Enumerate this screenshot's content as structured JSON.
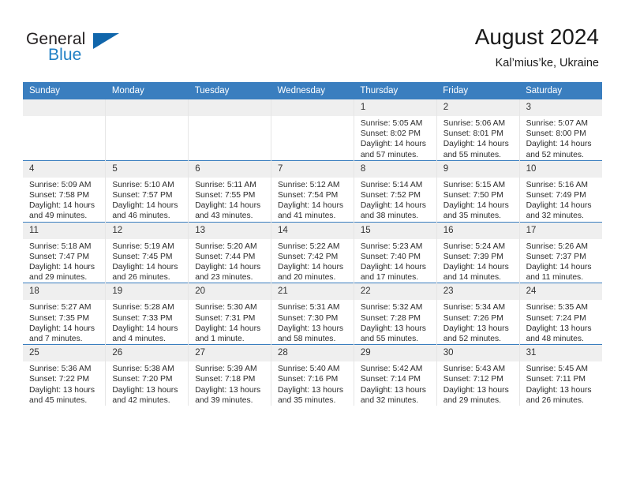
{
  "brand": {
    "name_part1": "General",
    "name_part2": "Blue",
    "triangle_color": "#1166ab",
    "blue_color": "#1f7fc4",
    "dark_color": "#231f20"
  },
  "header": {
    "month_title": "August 2024",
    "location": "Kal’mius’ke, Ukraine"
  },
  "theme": {
    "header_row_bg": "#3a7ebf",
    "daynum_bg": "#efefef",
    "row_rule": "#3a7ebf",
    "cell_border": "#e6e6e6"
  },
  "weekdays": [
    "Sunday",
    "Monday",
    "Tuesday",
    "Wednesday",
    "Thursday",
    "Friday",
    "Saturday"
  ],
  "labels": {
    "sunrise_prefix": "Sunrise:",
    "sunset_prefix": "Sunset:",
    "daylight_prefix": "Daylight:"
  },
  "weeks": [
    [
      {
        "day": "",
        "empty": true
      },
      {
        "day": "",
        "empty": true
      },
      {
        "day": "",
        "empty": true
      },
      {
        "day": "",
        "empty": true
      },
      {
        "day": "1",
        "sunrise": "Sunrise: 5:05 AM",
        "sunset": "Sunset: 8:02 PM",
        "daylight_1": "Daylight: 14 hours",
        "daylight_2": "and 57 minutes."
      },
      {
        "day": "2",
        "sunrise": "Sunrise: 5:06 AM",
        "sunset": "Sunset: 8:01 PM",
        "daylight_1": "Daylight: 14 hours",
        "daylight_2": "and 55 minutes."
      },
      {
        "day": "3",
        "sunrise": "Sunrise: 5:07 AM",
        "sunset": "Sunset: 8:00 PM",
        "daylight_1": "Daylight: 14 hours",
        "daylight_2": "and 52 minutes."
      }
    ],
    [
      {
        "day": "4",
        "sunrise": "Sunrise: 5:09 AM",
        "sunset": "Sunset: 7:58 PM",
        "daylight_1": "Daylight: 14 hours",
        "daylight_2": "and 49 minutes."
      },
      {
        "day": "5",
        "sunrise": "Sunrise: 5:10 AM",
        "sunset": "Sunset: 7:57 PM",
        "daylight_1": "Daylight: 14 hours",
        "daylight_2": "and 46 minutes."
      },
      {
        "day": "6",
        "sunrise": "Sunrise: 5:11 AM",
        "sunset": "Sunset: 7:55 PM",
        "daylight_1": "Daylight: 14 hours",
        "daylight_2": "and 43 minutes."
      },
      {
        "day": "7",
        "sunrise": "Sunrise: 5:12 AM",
        "sunset": "Sunset: 7:54 PM",
        "daylight_1": "Daylight: 14 hours",
        "daylight_2": "and 41 minutes."
      },
      {
        "day": "8",
        "sunrise": "Sunrise: 5:14 AM",
        "sunset": "Sunset: 7:52 PM",
        "daylight_1": "Daylight: 14 hours",
        "daylight_2": "and 38 minutes."
      },
      {
        "day": "9",
        "sunrise": "Sunrise: 5:15 AM",
        "sunset": "Sunset: 7:50 PM",
        "daylight_1": "Daylight: 14 hours",
        "daylight_2": "and 35 minutes."
      },
      {
        "day": "10",
        "sunrise": "Sunrise: 5:16 AM",
        "sunset": "Sunset: 7:49 PM",
        "daylight_1": "Daylight: 14 hours",
        "daylight_2": "and 32 minutes."
      }
    ],
    [
      {
        "day": "11",
        "sunrise": "Sunrise: 5:18 AM",
        "sunset": "Sunset: 7:47 PM",
        "daylight_1": "Daylight: 14 hours",
        "daylight_2": "and 29 minutes."
      },
      {
        "day": "12",
        "sunrise": "Sunrise: 5:19 AM",
        "sunset": "Sunset: 7:45 PM",
        "daylight_1": "Daylight: 14 hours",
        "daylight_2": "and 26 minutes."
      },
      {
        "day": "13",
        "sunrise": "Sunrise: 5:20 AM",
        "sunset": "Sunset: 7:44 PM",
        "daylight_1": "Daylight: 14 hours",
        "daylight_2": "and 23 minutes."
      },
      {
        "day": "14",
        "sunrise": "Sunrise: 5:22 AM",
        "sunset": "Sunset: 7:42 PM",
        "daylight_1": "Daylight: 14 hours",
        "daylight_2": "and 20 minutes."
      },
      {
        "day": "15",
        "sunrise": "Sunrise: 5:23 AM",
        "sunset": "Sunset: 7:40 PM",
        "daylight_1": "Daylight: 14 hours",
        "daylight_2": "and 17 minutes."
      },
      {
        "day": "16",
        "sunrise": "Sunrise: 5:24 AM",
        "sunset": "Sunset: 7:39 PM",
        "daylight_1": "Daylight: 14 hours",
        "daylight_2": "and 14 minutes."
      },
      {
        "day": "17",
        "sunrise": "Sunrise: 5:26 AM",
        "sunset": "Sunset: 7:37 PM",
        "daylight_1": "Daylight: 14 hours",
        "daylight_2": "and 11 minutes."
      }
    ],
    [
      {
        "day": "18",
        "sunrise": "Sunrise: 5:27 AM",
        "sunset": "Sunset: 7:35 PM",
        "daylight_1": "Daylight: 14 hours",
        "daylight_2": "and 7 minutes."
      },
      {
        "day": "19",
        "sunrise": "Sunrise: 5:28 AM",
        "sunset": "Sunset: 7:33 PM",
        "daylight_1": "Daylight: 14 hours",
        "daylight_2": "and 4 minutes."
      },
      {
        "day": "20",
        "sunrise": "Sunrise: 5:30 AM",
        "sunset": "Sunset: 7:31 PM",
        "daylight_1": "Daylight: 14 hours",
        "daylight_2": "and 1 minute."
      },
      {
        "day": "21",
        "sunrise": "Sunrise: 5:31 AM",
        "sunset": "Sunset: 7:30 PM",
        "daylight_1": "Daylight: 13 hours",
        "daylight_2": "and 58 minutes."
      },
      {
        "day": "22",
        "sunrise": "Sunrise: 5:32 AM",
        "sunset": "Sunset: 7:28 PM",
        "daylight_1": "Daylight: 13 hours",
        "daylight_2": "and 55 minutes."
      },
      {
        "day": "23",
        "sunrise": "Sunrise: 5:34 AM",
        "sunset": "Sunset: 7:26 PM",
        "daylight_1": "Daylight: 13 hours",
        "daylight_2": "and 52 minutes."
      },
      {
        "day": "24",
        "sunrise": "Sunrise: 5:35 AM",
        "sunset": "Sunset: 7:24 PM",
        "daylight_1": "Daylight: 13 hours",
        "daylight_2": "and 48 minutes."
      }
    ],
    [
      {
        "day": "25",
        "sunrise": "Sunrise: 5:36 AM",
        "sunset": "Sunset: 7:22 PM",
        "daylight_1": "Daylight: 13 hours",
        "daylight_2": "and 45 minutes."
      },
      {
        "day": "26",
        "sunrise": "Sunrise: 5:38 AM",
        "sunset": "Sunset: 7:20 PM",
        "daylight_1": "Daylight: 13 hours",
        "daylight_2": "and 42 minutes."
      },
      {
        "day": "27",
        "sunrise": "Sunrise: 5:39 AM",
        "sunset": "Sunset: 7:18 PM",
        "daylight_1": "Daylight: 13 hours",
        "daylight_2": "and 39 minutes."
      },
      {
        "day": "28",
        "sunrise": "Sunrise: 5:40 AM",
        "sunset": "Sunset: 7:16 PM",
        "daylight_1": "Daylight: 13 hours",
        "daylight_2": "and 35 minutes."
      },
      {
        "day": "29",
        "sunrise": "Sunrise: 5:42 AM",
        "sunset": "Sunset: 7:14 PM",
        "daylight_1": "Daylight: 13 hours",
        "daylight_2": "and 32 minutes."
      },
      {
        "day": "30",
        "sunrise": "Sunrise: 5:43 AM",
        "sunset": "Sunset: 7:12 PM",
        "daylight_1": "Daylight: 13 hours",
        "daylight_2": "and 29 minutes."
      },
      {
        "day": "31",
        "sunrise": "Sunrise: 5:45 AM",
        "sunset": "Sunset: 7:11 PM",
        "daylight_1": "Daylight: 13 hours",
        "daylight_2": "and 26 minutes."
      }
    ]
  ]
}
